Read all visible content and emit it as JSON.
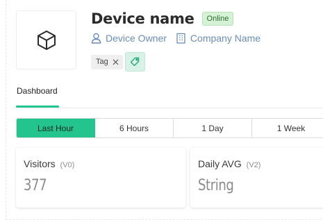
{
  "device": {
    "name": "Device name",
    "status": "Online",
    "owner": "Device Owner",
    "company": "Company Name",
    "image_icon": "cube-icon"
  },
  "tags": [
    {
      "label": "Tag"
    }
  ],
  "tabs": [
    {
      "label": "Dashboard",
      "active": true
    }
  ],
  "time_ranges": [
    {
      "label": "Last Hour",
      "active": true
    },
    {
      "label": "6 Hours",
      "active": false
    },
    {
      "label": "1 Day",
      "active": false
    },
    {
      "label": "1 Week",
      "active": false
    }
  ],
  "widgets": [
    {
      "title": "Visitors",
      "pin": "(V0)",
      "value": "377"
    },
    {
      "title": "Daily AVG",
      "pin": "(V2)",
      "value": "String"
    }
  ],
  "colors": {
    "accent": "#23c48e",
    "online_badge_bg": "#d6f2d6",
    "link_blue": "#6a8cba"
  }
}
